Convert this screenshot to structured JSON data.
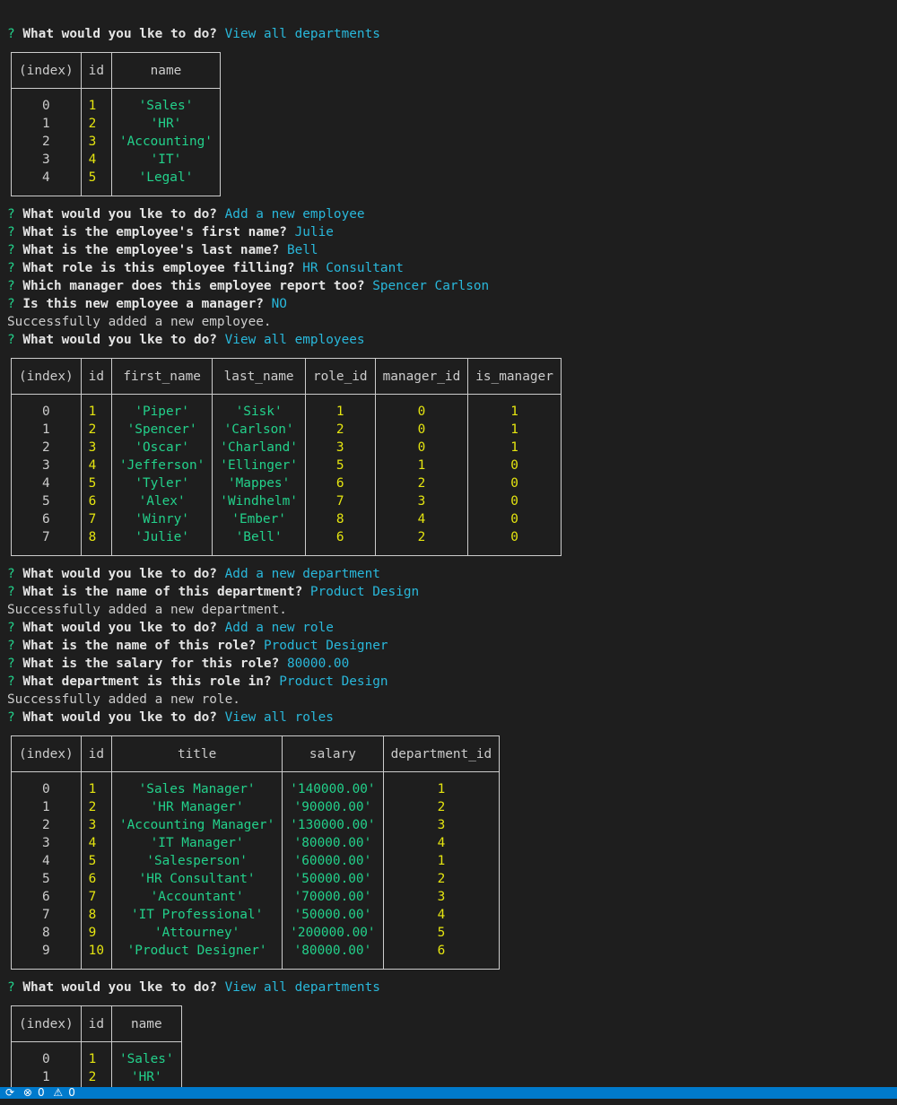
{
  "prompts": {
    "q1": {
      "mark": "?",
      "text": "What would you lke to do?",
      "answer": "View all departments"
    },
    "q2": {
      "mark": "?",
      "text": "What would you lke to do?",
      "answer": "Add a new employee"
    },
    "q3": {
      "mark": "?",
      "text": "What is the employee's first name?",
      "answer": "Julie"
    },
    "q4": {
      "mark": "?",
      "text": "What is the employee's last name?",
      "answer": "Bell"
    },
    "q5": {
      "mark": "?",
      "text": "What role is this employee filling?",
      "answer": "HR Consultant"
    },
    "q6": {
      "mark": "?",
      "text": "Which manager does this employee report too?",
      "answer": "Spencer Carlson"
    },
    "q7": {
      "mark": "?",
      "text": "Is this new employee a manager?",
      "answer": "NO"
    },
    "msg1": "Successfully added a new employee.",
    "q8": {
      "mark": "?",
      "text": "What would you lke to do?",
      "answer": "View all employees"
    },
    "q9": {
      "mark": "?",
      "text": "What would you lke to do?",
      "answer": "Add a new department"
    },
    "q10": {
      "mark": "?",
      "text": "What is the name of this department?",
      "answer": "Product Design"
    },
    "msg2": "Successfully added a new department.",
    "q11": {
      "mark": "?",
      "text": "What would you lke to do?",
      "answer": "Add a new role"
    },
    "q12": {
      "mark": "?",
      "text": "What is the name of this role?",
      "answer": "Product Designer"
    },
    "q13": {
      "mark": "?",
      "text": "What is the salary for this role?",
      "answer": "80000.00"
    },
    "q14": {
      "mark": "?",
      "text": "What department is this role in?",
      "answer": "Product Design"
    },
    "msg3": "Successfully added a new role.",
    "q15": {
      "mark": "?",
      "text": "What would you lke to do?",
      "answer": "View all roles"
    },
    "q16": {
      "mark": "?",
      "text": "What would you lke to do?",
      "answer": "View all departments"
    }
  },
  "tables": {
    "departments1": {
      "headers": [
        "(index)",
        "id",
        "name"
      ],
      "rows": [
        [
          "0",
          "1",
          "'Sales'"
        ],
        [
          "1",
          "2",
          "'HR'"
        ],
        [
          "2",
          "3",
          "'Accounting'"
        ],
        [
          "3",
          "4",
          "'IT'"
        ],
        [
          "4",
          "5",
          "'Legal'"
        ]
      ]
    },
    "employees": {
      "headers": [
        "(index)",
        "id",
        "first_name",
        "last_name",
        "role_id",
        "manager_id",
        "is_manager"
      ],
      "rows": [
        [
          "0",
          "1",
          "'Piper'",
          "'Sisk'",
          "1",
          "0",
          "1"
        ],
        [
          "1",
          "2",
          "'Spencer'",
          "'Carlson'",
          "2",
          "0",
          "1"
        ],
        [
          "2",
          "3",
          "'Oscar'",
          "'Charland'",
          "3",
          "0",
          "1"
        ],
        [
          "3",
          "4",
          "'Jefferson'",
          "'Ellinger'",
          "5",
          "1",
          "0"
        ],
        [
          "4",
          "5",
          "'Tyler'",
          "'Mappes'",
          "6",
          "2",
          "0"
        ],
        [
          "5",
          "6",
          "'Alex'",
          "'Windhelm'",
          "7",
          "3",
          "0"
        ],
        [
          "6",
          "7",
          "'Winry'",
          "'Ember'",
          "8",
          "4",
          "0"
        ],
        [
          "7",
          "8",
          "'Julie'",
          "'Bell'",
          "6",
          "2",
          "0"
        ]
      ]
    },
    "roles": {
      "headers": [
        "(index)",
        "id",
        "title",
        "salary",
        "department_id"
      ],
      "rows": [
        [
          "0",
          "1",
          "'Sales Manager'",
          "'140000.00'",
          "1"
        ],
        [
          "1",
          "2",
          "'HR Manager'",
          "'90000.00'",
          "2"
        ],
        [
          "2",
          "3",
          "'Accounting Manager'",
          "'130000.00'",
          "3"
        ],
        [
          "3",
          "4",
          "'IT Manager'",
          "'80000.00'",
          "4"
        ],
        [
          "4",
          "5",
          "'Salesperson'",
          "'60000.00'",
          "1"
        ],
        [
          "5",
          "6",
          "'HR Consultant'",
          "'50000.00'",
          "2"
        ],
        [
          "6",
          "7",
          "'Accountant'",
          "'70000.00'",
          "3"
        ],
        [
          "7",
          "8",
          "'IT Professional'",
          "'50000.00'",
          "4"
        ],
        [
          "8",
          "9",
          "'Attourney'",
          "'200000.00'",
          "5"
        ],
        [
          "9",
          "10",
          "'Product Designer'",
          "'80000.00'",
          "6"
        ]
      ]
    },
    "departments2": {
      "headers": [
        "(index)",
        "id",
        "name"
      ],
      "rows": [
        [
          "0",
          "1",
          "'Sales'"
        ],
        [
          "1",
          "2",
          "'HR'"
        ]
      ]
    }
  },
  "statusbar": {
    "errors": "0",
    "warnings": "0",
    "error_icon": "error-circle-icon",
    "warning_icon": "warning-triangle-icon",
    "sync_icon": "sync-icon"
  },
  "colors": {
    "background": "#1e1e1e",
    "prompt_mark": "#23d18b",
    "answer": "#29b8db",
    "number": "#e5e510",
    "string": "#23d18b",
    "statusbar": "#007acc"
  }
}
